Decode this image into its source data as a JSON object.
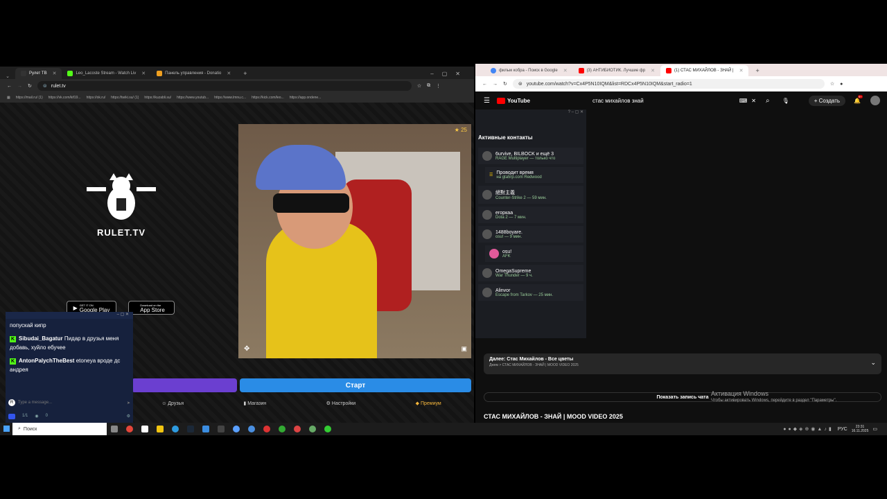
{
  "left_browser": {
    "tabs": [
      {
        "label": "Рулет ТВ",
        "active": true
      },
      {
        "label": "Leo_Lacoste Stream - Watch Liv",
        "active": false
      },
      {
        "label": "Панель управления - Donatio",
        "active": false
      }
    ],
    "address": "rulet.tv",
    "bookmarks": [
      "https://mail.ru/ (1)",
      "https://vk.com/kif19...",
      "https://ok.ru/",
      "https://twiki.su/ (1)",
      "https://kuzabli.su/",
      "https://www.youtub...",
      "https://www.lmnu.c...",
      "https://kick.com/leo...",
      "https://app.ondene..."
    ],
    "logo_text": "RULET.TV",
    "store_google_small": "GET IT ON",
    "store_google": "Google Play",
    "store_apple_small": "Download on the",
    "store_apple": "App Store",
    "cam_star_count": "25",
    "start_button": "Старт",
    "nav": [
      "Друзья",
      "Магазин",
      "Настройки",
      "Премиум"
    ]
  },
  "chat": {
    "messages": [
      {
        "user": "",
        "text": "попускай кипр"
      },
      {
        "user": "Sibudai_Bagatur",
        "text": "Пидар в друзья меня добавь, хуйло ебучее"
      },
      {
        "user": "AntonPalychTheBest",
        "text": "etoneya вроде дс андрея"
      }
    ],
    "input_placeholder": "Type a message...",
    "viewers": "1/1",
    "count": "0"
  },
  "right_browser": {
    "tabs": [
      {
        "label": "фильм кобра - Поиск в Google",
        "active": false
      },
      {
        "label": "(3) АНТИБИОТИК. Лучшие фр",
        "active": false
      },
      {
        "label": "(1) СТАС МИХАЙЛОВ - ЗНАЙ |",
        "active": true
      }
    ],
    "address": "youtube.com/watch?v=Cx4P5N10IQM&list=RDCx4P5N10IQM&start_radio=1",
    "search_query": "стас михайлов знай",
    "create_label": "Создать",
    "notif_count": "9+"
  },
  "steam": {
    "title": "Активные контакты",
    "contacts": [
      {
        "name": "6urvive, BILBOCK и ещё 3",
        "game": "RAGE Multiplayer — только что"
      },
      {
        "name": "Проводит время",
        "game": "на gta5rp.com Redwood"
      },
      {
        "name": "絕對主義",
        "game": "Counter-Strike 2 — 59 мин."
      },
      {
        "name": "егоркаа",
        "game": "Dota 2 — 7 мин."
      },
      {
        "name": "1488boyare.",
        "game": "osu! — 9 мин."
      },
      {
        "name": "osu!",
        "game": "AFK"
      },
      {
        "name": "OmegaSupreme",
        "game": "War Thunder — 9 ч."
      },
      {
        "name": "Alinvor",
        "game": "Escape from Tarkov — 25 мин."
      }
    ]
  },
  "youtube": {
    "next_label": "Далее: Стас Михайлов - Все цветы",
    "next_sub": "Джем > СТАС МИХАЙЛОВ - ЗНАЙ | MOOD VIDEO 2025",
    "show_chat": "Показать запись чата",
    "video_title": "СТАС МИХАЙЛОВ - ЗНАЙ | MOOD VIDEO 2025"
  },
  "windows": {
    "activation_title": "Активация Windows",
    "activation_sub": "Чтобы активировать Windows, перейдите в раздел \"Параметры\".",
    "search": "Поиск",
    "lang": "РУС",
    "time": "23:31",
    "date": "16.11.2025"
  }
}
